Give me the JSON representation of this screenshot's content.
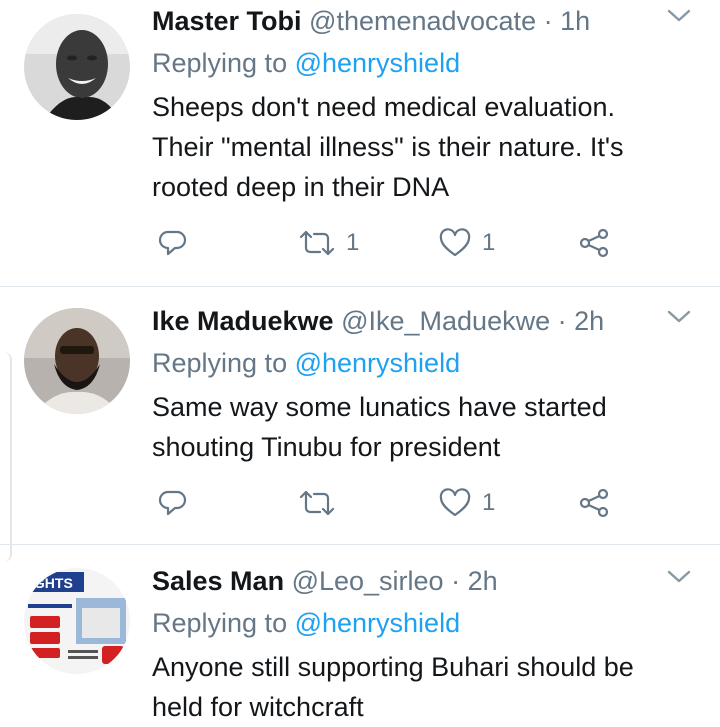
{
  "tweets": [
    {
      "name": "Master Tobi",
      "handle": "@themenadvocate",
      "dot": " · ",
      "time": "1h",
      "replying_prefix": "Replying to ",
      "replying_to": "@henryshield",
      "body_lines": [
        "Sheeps don't need medical evaluation.",
        "Their \"mental illness\" is their nature. It's",
        "rooted deep in their DNA"
      ],
      "retweets": "1",
      "likes": "1",
      "avatar_icon": "avatar-man-smiling"
    },
    {
      "name": "Ike Maduekwe",
      "handle": "@Ike_Maduekwe",
      "dot": " · ",
      "time": "2h",
      "replying_prefix": "Replying to ",
      "replying_to": "@henryshield",
      "body_lines": [
        "Same way some lunatics have started",
        "shouting Tinubu for president"
      ],
      "retweets": "",
      "likes": "1",
      "avatar_icon": "avatar-man-bearded"
    },
    {
      "name": "Sales Man",
      "handle": "@Leo_sirleo",
      "dot": " · ",
      "time": "2h",
      "replying_prefix": "Replying to ",
      "replying_to": "@henryshield",
      "body_lines": [
        "Anyone still supporting Buhari should be",
        "held for witchcraft"
      ],
      "avatar_icon": "avatar-real-estate-flyer",
      "avatar_text": "IGHTS"
    }
  ],
  "colors": {
    "text": "#14171a",
    "secondary": "#657786",
    "link": "#1da1f2",
    "divider": "#e1e8ed"
  },
  "icons": [
    "reply-icon",
    "retweet-icon",
    "like-icon",
    "share-icon",
    "chevron-down-icon"
  ]
}
